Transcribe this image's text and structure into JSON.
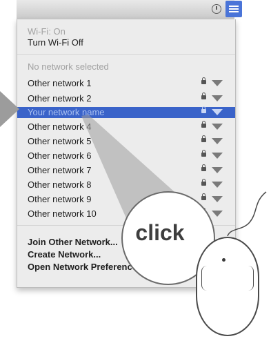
{
  "menubar": {
    "icons": [
      "clock-icon",
      "wifi-icon"
    ],
    "active_color": "#4a74d8"
  },
  "wifi_menu": {
    "status": "Wi-Fi: On",
    "toggle": "Turn Wi-Fi Off",
    "no_network": "No network selected",
    "networks": [
      {
        "name": "Other network 1",
        "locked": true
      },
      {
        "name": "Other network 2",
        "locked": true
      },
      {
        "name": "Your network name",
        "locked": true,
        "selected": true
      },
      {
        "name": "Other network 4",
        "locked": true
      },
      {
        "name": "Other network 5",
        "locked": true
      },
      {
        "name": "Other network 6",
        "locked": true
      },
      {
        "name": "Other network 7",
        "locked": true
      },
      {
        "name": "Other network 8",
        "locked": true
      },
      {
        "name": "Other network 9",
        "locked": true
      },
      {
        "name": "Other network 10",
        "locked": true
      }
    ],
    "actions": [
      "Join Other Network...",
      "Create Network...",
      "Open Network Preferences..."
    ],
    "selected_color": "#3a63c9"
  },
  "callout": {
    "label": "click",
    "icons": [
      "pointer-arrow",
      "magnifier",
      "mouse-icon"
    ]
  }
}
